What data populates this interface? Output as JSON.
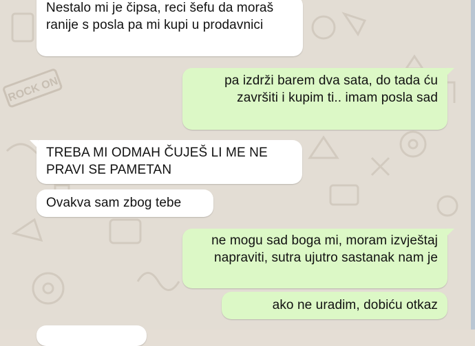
{
  "conversation": {
    "messages": [
      {
        "direction": "incoming",
        "text": "Nestalo mi je čipsa, reci šefu da moraš ranije s posla pa mi kupi u prodavnici"
      },
      {
        "direction": "outgoing",
        "text": "pa izdrži barem dva sata, do tada ću završiti i kupim ti.. imam posla sad"
      },
      {
        "direction": "incoming",
        "text": "TREBA MI ODMAH ČUJEŠ LI ME NE PRAVI SE PAMETAN"
      },
      {
        "direction": "incoming",
        "text": "Ovakva sam zbog tebe"
      },
      {
        "direction": "outgoing",
        "text": "ne mogu sad boga mi, moram izvještaj napraviti, sutra ujutro sastanak nam je"
      },
      {
        "direction": "outgoing",
        "text": "ako ne uradim, dobiću otkaz"
      }
    ]
  },
  "wallpaper_text": "ROCK ON",
  "colors": {
    "incoming_bubble": "#ffffff",
    "outgoing_bubble": "#dcf8c6",
    "wallpaper": "#e3ddd4",
    "doodle": "#d3cbc0"
  }
}
